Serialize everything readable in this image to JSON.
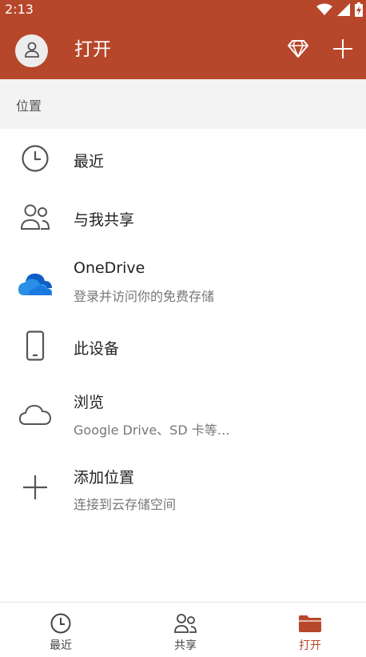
{
  "status_bar": {
    "time": "2:13"
  },
  "app_bar": {
    "title": "打开"
  },
  "section": {
    "header": "位置"
  },
  "locations": [
    {
      "title": "最近",
      "subtitle": "",
      "icon": "clock-icon"
    },
    {
      "title": "与我共享",
      "subtitle": "",
      "icon": "people-icon"
    },
    {
      "title": "OneDrive",
      "subtitle": "登录并访问你的免费存储",
      "icon": "onedrive-cloud-icon"
    },
    {
      "title": "此设备",
      "subtitle": "",
      "icon": "phone-icon"
    },
    {
      "title": "浏览",
      "subtitle": "Google Drive、SD 卡等…",
      "icon": "cloud-outline-icon"
    },
    {
      "title": "添加位置",
      "subtitle": "连接到云存储空间",
      "icon": "plus-icon"
    }
  ],
  "bottom_nav": [
    {
      "label": "最近",
      "icon": "clock-icon",
      "active": false
    },
    {
      "label": "共享",
      "icon": "people-icon",
      "active": false
    },
    {
      "label": "打开",
      "icon": "folder-icon",
      "active": true
    }
  ],
  "colors": {
    "accent": "#b7472a",
    "header_bg": "#f3f3f3",
    "onedrive_blue": "#1a6fc9"
  }
}
